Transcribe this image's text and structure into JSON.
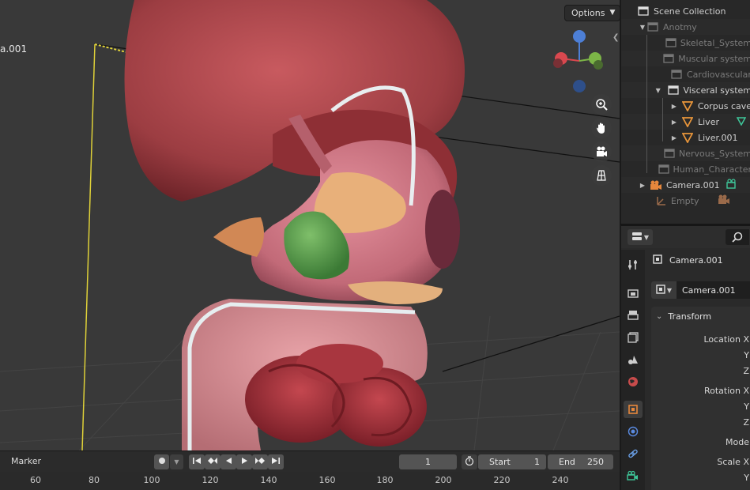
{
  "viewport": {
    "camera_label": "a.001",
    "options_label": "Options",
    "nav_buttons": [
      "zoom-icon",
      "hand-pan-icon",
      "camera-view-icon",
      "ortho-grid-icon"
    ],
    "gizmo_axis": "Z"
  },
  "outliner": {
    "rows": [
      {
        "label": "Scene Collection",
        "style": "normal",
        "icon": "collection-icon"
      },
      {
        "label": "Anotmy",
        "style": "dim",
        "icon": "collection-icon"
      },
      {
        "label": "Skeletal_System",
        "style": "dim",
        "icon": "collection-icon"
      },
      {
        "label": "Muscular system",
        "style": "dim",
        "icon": "collection-icon"
      },
      {
        "label": "Cardiovascular",
        "style": "dim",
        "icon": "collection-icon"
      },
      {
        "label": "Visceral system",
        "style": "normal",
        "icon": "collection-icon"
      },
      {
        "label": "Corpus cave",
        "style": "normal",
        "icon": "mesh-icon"
      },
      {
        "label": "Liver",
        "style": "normal",
        "icon": "mesh-icon"
      },
      {
        "label": "Liver.001",
        "style": "normal",
        "icon": "mesh-icon"
      },
      {
        "label": "Nervous_System",
        "style": "dim",
        "icon": "collection-icon"
      },
      {
        "label": "Human_Character",
        "style": "dim",
        "icon": "collection-icon"
      },
      {
        "label": "Camera.001",
        "style": "normal",
        "icon": "camera-object-icon"
      },
      {
        "label": "Empty",
        "style": "dim",
        "icon": "empty-icon"
      }
    ]
  },
  "properties": {
    "object_name": "Camera.001",
    "object_field": "Camera.001",
    "panel_title": "Transform",
    "labels": {
      "location_x": "Location X",
      "location_y": "Y",
      "location_z": "Z",
      "rotation_x": "Rotation X",
      "rotation_y": "Y",
      "rotation_z": "Z",
      "mode": "Mode",
      "scale_x": "Scale X",
      "scale_y": "Y"
    },
    "tabs": [
      "tool-icon",
      "render-icon",
      "output-icon",
      "view-layer-icon",
      "scene-icon",
      "world-icon",
      "object-icon",
      "physics-icon",
      "constraints-icon",
      "camera-data-icon"
    ]
  },
  "timeline": {
    "marker_label": "Marker",
    "current_frame": "1",
    "start_label": "Start",
    "start_value": "1",
    "end_label": "End",
    "end_value": "250",
    "ruler_ticks": [
      "60",
      "80",
      "100",
      "120",
      "140",
      "160",
      "180",
      "200",
      "220",
      "240"
    ]
  },
  "colors": {
    "selection": "#334d80",
    "active_object_orange": "#e6873c",
    "mesh_orange": "#e8953a",
    "camera_green": "#3ec79a"
  }
}
